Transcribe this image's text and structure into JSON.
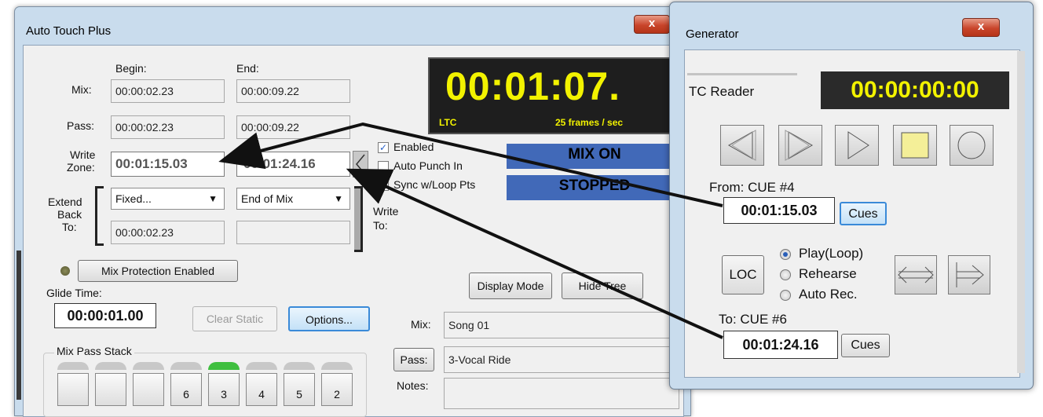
{
  "auto_touch": {
    "title": "Auto Touch Plus",
    "close": "x",
    "begin_header": "Begin:",
    "end_header": "End:",
    "mix_label": "Mix:",
    "mix_begin": "00:00:02.23",
    "mix_end": "00:00:09.22",
    "pass_label": "Pass:",
    "pass_begin": "00:00:02.23",
    "pass_end": "00:00:09.22",
    "write_zone_label_1": "Write",
    "write_zone_label_2": "Zone:",
    "write_begin": "00:01:15.03",
    "write_end": "00:01:24.16",
    "extend_label_1": "Extend",
    "extend_label_2": "Back",
    "extend_label_3": "To:",
    "extend_mode": "Fixed...",
    "extend_value": "00:00:02.23",
    "end_mode": "End of Mix",
    "end_value": "",
    "write_to_label_1": "Write",
    "write_to_label_2": "To:",
    "timecode": "00:01:07.",
    "tc_source": "LTC",
    "frame_rate": "25 frames / sec",
    "enabled_label": "Enabled",
    "enabled_checked": true,
    "auto_punch_label": "Auto Punch In",
    "auto_punch_checked": false,
    "sync_loop_label": "Sync w/Loop Pts",
    "sync_loop_checked": true,
    "mix_status": "MIX ON",
    "transport_status": "STOPPED",
    "mix_protection_button": "Mix Protection Enabled",
    "glide_time_label": "Glide Time:",
    "glide_time": "00:00:01.00",
    "clear_static_button": "Clear Static",
    "options_button": "Options...",
    "display_mode_button": "Display Mode",
    "hide_tree_button": "Hide Tree",
    "mix_field_label": "Mix:",
    "mix_name": "Song 01",
    "pass_button": "Pass:",
    "pass_name": "3-Vocal Ride",
    "notes_label": "Notes:",
    "mix_pass_stack_label": "Mix Pass Stack",
    "stack_cells": [
      "",
      "",
      "",
      "6",
      "3",
      "4",
      "5",
      "2"
    ],
    "stack_active_index": 4
  },
  "generator": {
    "title": "Generator",
    "close": "x",
    "tc_reader_label": "TC Reader",
    "tc_reader_value": "00:00:00:00",
    "from_label": "From: CUE #4",
    "from_value": "00:01:15.03",
    "cues_button_1": "Cues",
    "loc_button": "LOC",
    "play_loop_label": "Play(Loop)",
    "rehearse_label": "Rehearse",
    "auto_rec_label": "Auto Rec.",
    "selected_mode": "Play(Loop)",
    "to_label": "To: CUE #6",
    "to_value": "00:01:24.16",
    "cues_button_2": "Cues"
  },
  "colors": {
    "tc_yellow": "#f2f200",
    "tc_background": "#1e1e1e",
    "status_blue": "#4169b8",
    "stack_active": "#3fbf3f"
  }
}
